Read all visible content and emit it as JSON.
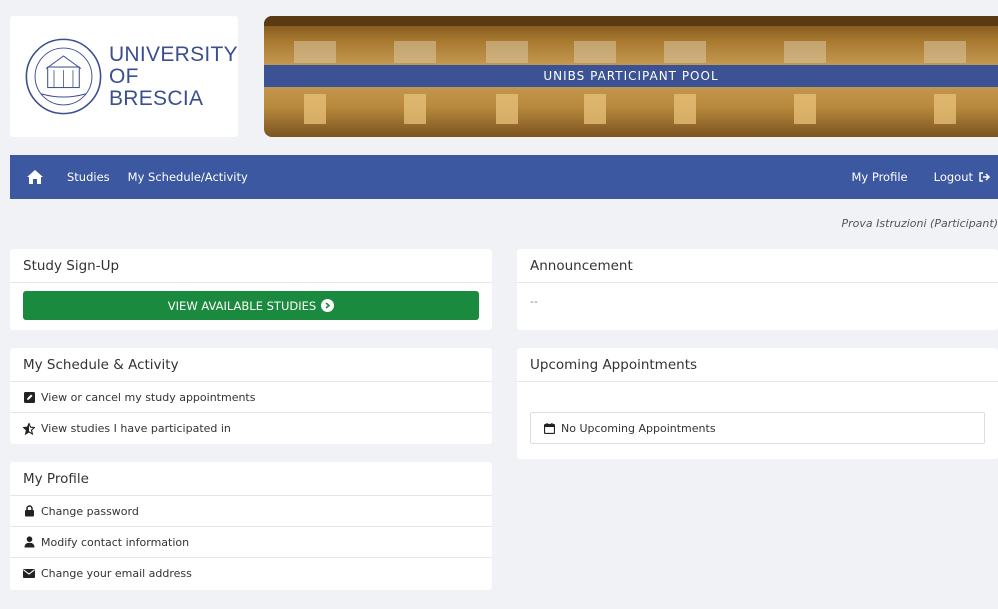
{
  "header": {
    "logo_line1": "UNIVERSITY",
    "logo_line2": "OF BRESCIA",
    "banner_title": "UNIBS PARTICIPANT POOL"
  },
  "navbar": {
    "home_icon": "home-icon",
    "studies_label": "Studies",
    "schedule_label": "My Schedule/Activity",
    "profile_label": "My Profile",
    "logout_label": "Logout",
    "logout_icon": "sign-out-icon",
    "bg_color": "#3b58a0"
  },
  "user_line": "Prova Istruzioni (Participant)",
  "signup": {
    "title": "Study Sign-Up",
    "button_label": "VIEW AVAILABLE STUDIES",
    "button_color": "#1a8a3e"
  },
  "schedule": {
    "title": "My Schedule & Activity",
    "items": [
      {
        "icon": "edit-icon",
        "label": "View or cancel my study appointments"
      },
      {
        "icon": "star-half-icon",
        "label": "View studies I have participated in"
      }
    ]
  },
  "profile": {
    "title": "My Profile",
    "items": [
      {
        "icon": "lock-icon",
        "label": "Change password"
      },
      {
        "icon": "user-icon",
        "label": "Modify contact information"
      },
      {
        "icon": "envelope-icon",
        "label": "Change your email address"
      }
    ]
  },
  "announcement": {
    "title": "Announcement",
    "body": "--"
  },
  "appointments": {
    "title": "Upcoming Appointments",
    "empty_label": "No Upcoming Appointments",
    "empty_icon": "calendar-icon"
  }
}
